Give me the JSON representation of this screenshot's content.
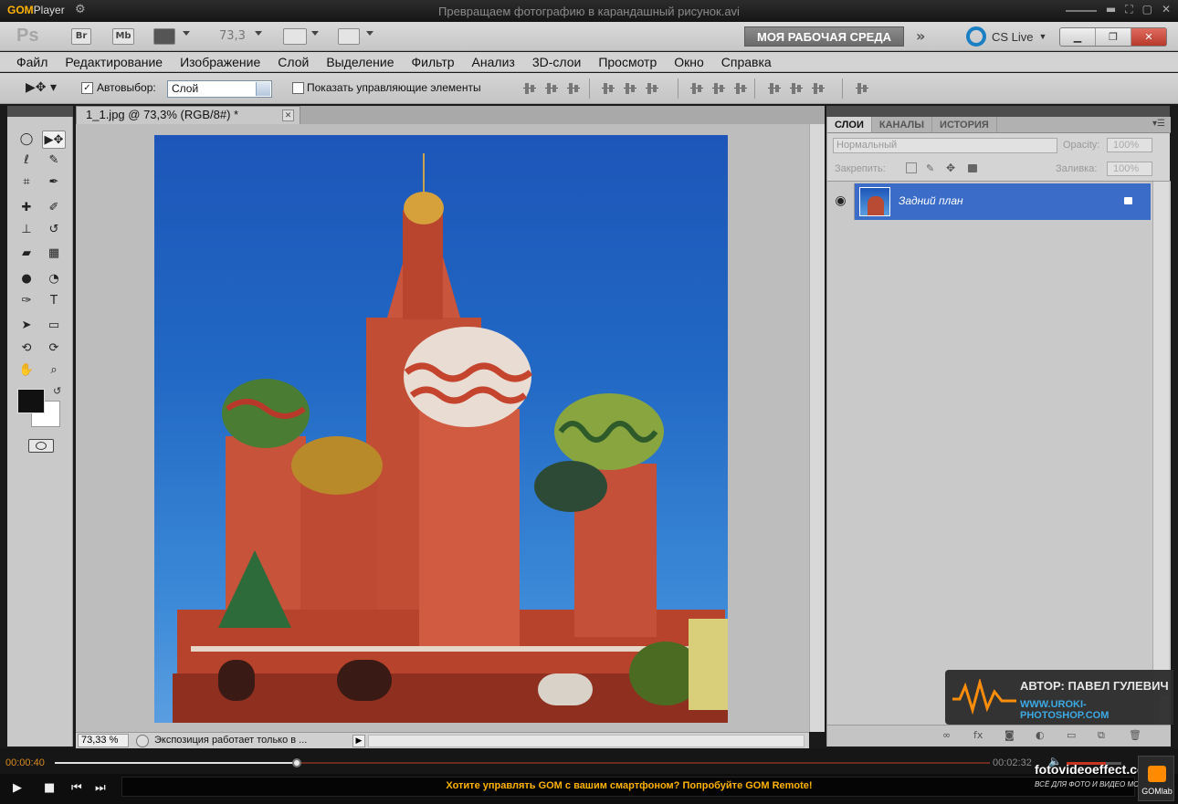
{
  "gom": {
    "logo_brand": "GOM",
    "logo_product": "Player",
    "file_title": "Превращаем фотографию в карандашный рисунок.avi",
    "ticker": "Хотите управлять GOM с вашим смартфоном? Попробуйте GOM Remote!",
    "time_current": "00:00:40",
    "time_total": "00:02:32",
    "progress": 0.26,
    "volume": 0.72,
    "gomlab_label": "GOMlab"
  },
  "photoshop": {
    "logo": "Ps",
    "bridge_label": "Br",
    "minibridge_label": "Mb",
    "zoom_combo": "73,3",
    "workspace_label": "МОЯ РАБОЧАЯ СРЕДА",
    "workspace_more": "»",
    "cslive_label": "CS Live",
    "menu": [
      "Файл",
      "Редактирование",
      "Изображение",
      "Слой",
      "Выделение",
      "Фильтр",
      "Анализ",
      "3D-слои",
      "Просмотр",
      "Окно",
      "Справка"
    ],
    "options": {
      "autoselect_label": "Автовыбор:",
      "autoselect_value": "Слой",
      "show_transform_label": "Показать управляющие элементы"
    },
    "document": {
      "tab_title": "1_1.jpg @ 73,3% (RGB/8#) *",
      "zoom_status": "73,33 %",
      "status_msg": "Экспозиция работает только в ..."
    },
    "layers_panel": {
      "tabs": [
        "СЛОИ",
        "КАНАЛЫ",
        "ИСТОРИЯ"
      ],
      "blend_mode": "Нормальный",
      "opacity_label": "Opacity:",
      "opacity_value": "100%",
      "lock_label": "Закрепить:",
      "fill_label": "Заливка:",
      "fill_value": "100%",
      "layer_name": "Задний план"
    }
  },
  "watermark": {
    "author": "АВТОР: ПАВЕЛ ГУЛЕВИЧ",
    "site": "WWW.UROKI-PHOTOSHOP.COM",
    "channel": "fotovideoeffect.com",
    "channel_sub": "ВСЁ ДЛЯ ФОТО И ВИДЕО МОНТАЖА!"
  },
  "colors": {
    "gom_accent": "#ffb300",
    "seek_played": "#e0e0e0",
    "volume": "#c73623",
    "layer_selected": "#3a6cc8",
    "cslive": "#1b7fc4"
  }
}
